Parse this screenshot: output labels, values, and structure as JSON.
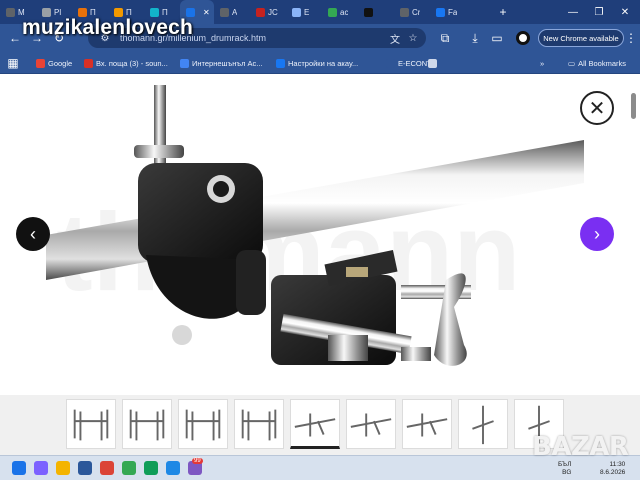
{
  "watermark": {
    "text": "muzikalenlovech"
  },
  "bazar_watermark": {
    "text": "BAZAR"
  },
  "browser": {
    "tabs": [
      {
        "label": "M",
        "color": "#5f6368"
      },
      {
        "label": "Pl",
        "color": "#9aa0a6"
      },
      {
        "label": "П",
        "color": "#e8710a"
      },
      {
        "label": "П",
        "color": "#f29900"
      },
      {
        "label": "П",
        "color": "#12b5cb"
      },
      {
        "label": "",
        "color": "#1a73e8",
        "active": true
      },
      {
        "label": "A",
        "color": "#5f6368"
      },
      {
        "label": "JC",
        "color": "#c5221f"
      },
      {
        "label": "E",
        "color": "#8ab4f8"
      },
      {
        "label": "ac",
        "color": "#34a853"
      },
      {
        "label": "",
        "color": "#111111"
      },
      {
        "label": "Cr",
        "color": "#5f6368"
      },
      {
        "label": "Fa",
        "color": "#1877f2"
      }
    ],
    "omnibox": {
      "url": "thomann.gr/millenium_drumrack.htm"
    },
    "update_button": {
      "label": "New Chrome available"
    },
    "bookmarks": [
      {
        "label": "Google",
        "color": "#ea4335"
      },
      {
        "label": "Вх. поща (3) - soun...",
        "color": "#d93025"
      },
      {
        "label": "Интернешънъл Ас...",
        "color": "#4285f4"
      },
      {
        "label": "Настройки на акау...",
        "color": "#1877f2"
      },
      {
        "label": "E-ECONT",
        "color": "#2f5596"
      },
      {
        "label": "",
        "color": "#cfd8ea"
      }
    ],
    "all_bookmarks": "All Bookmarks"
  },
  "gallery": {
    "brand_watermark": "thomann",
    "thumb_count": 9,
    "active_thumb": 5
  },
  "taskbar": {
    "lang": "БЪЛ",
    "region": "BG",
    "time": "11:30",
    "date": "8.6.2026",
    "notification_count": "99",
    "apps": [
      {
        "icon": "windows-start-icon",
        "color": "#1a73e8"
      },
      {
        "icon": "copilot-icon",
        "color": "#7b61ff"
      },
      {
        "icon": "file-explorer-icon",
        "color": "#f4b400"
      },
      {
        "icon": "mail-icon",
        "color": "#2b579a"
      },
      {
        "icon": "chrome-icon",
        "color": "#db4437"
      },
      {
        "icon": "app-icon",
        "color": "#34a853"
      },
      {
        "icon": "app-icon",
        "color": "#0f9d58"
      },
      {
        "icon": "app-icon",
        "color": "#1e88e5"
      },
      {
        "icon": "app-icon",
        "color": "#7e57c2"
      }
    ]
  },
  "colors": {
    "chrome_bg": "#2f5596",
    "next_button": "#7a2ff2",
    "prev_button": "#111111"
  }
}
